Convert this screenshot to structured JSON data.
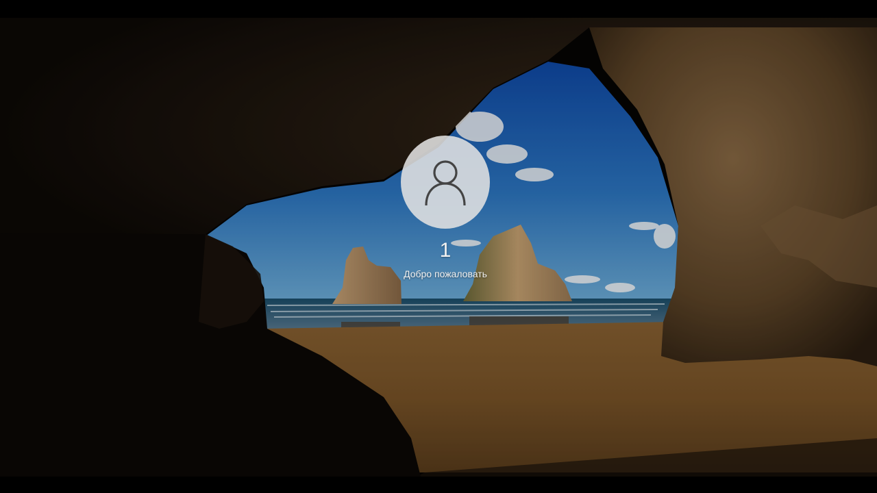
{
  "lock_screen": {
    "background_image": "cave-beach-wallpaper",
    "avatar_icon": "user-silhouette-icon",
    "username": "1",
    "status_text": "Добро пожаловать"
  },
  "colors": {
    "text": "#f2f2f2",
    "avatar_circle": "#e1e1e1",
    "avatar_icon": "#444444"
  }
}
